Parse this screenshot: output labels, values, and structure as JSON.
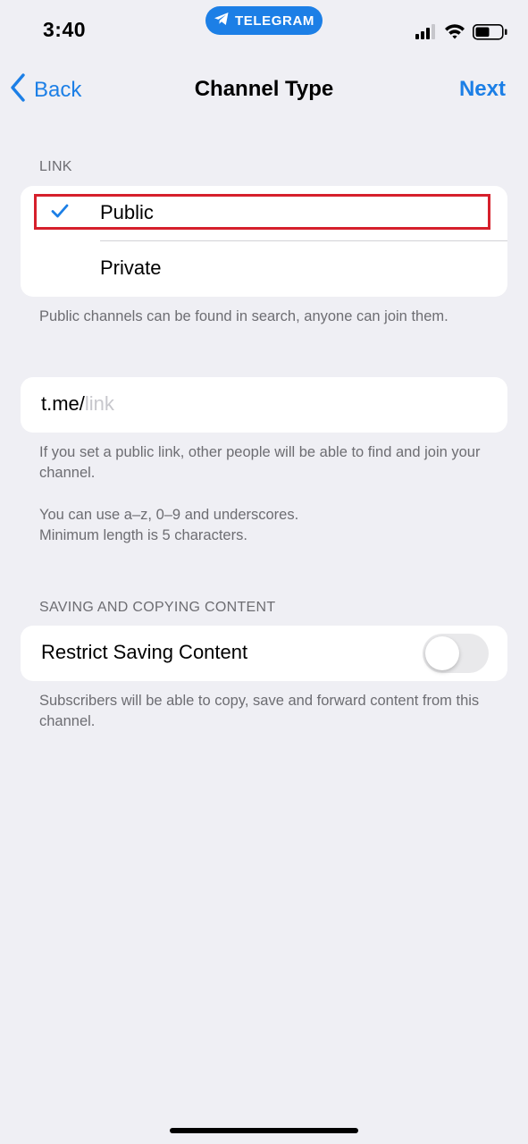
{
  "status_bar": {
    "time": "3:40",
    "app_name": "TELEGRAM",
    "icons": [
      "cellular-signal-icon",
      "wifi-icon",
      "battery-icon"
    ]
  },
  "nav": {
    "back_label": "Back",
    "title": "Channel Type",
    "next_label": "Next"
  },
  "link_section": {
    "header": "LINK",
    "options": [
      {
        "label": "Public",
        "selected": true
      },
      {
        "label": "Private",
        "selected": false
      }
    ],
    "footnote": "Public channels can be found in search, anyone can join them."
  },
  "public_link": {
    "prefix": "t.me/",
    "placeholder": "link",
    "footnote_1": "If you set a public link, other people will be able to find and join your channel.",
    "footnote_2_line1": "You can use a–z, 0–9 and underscores.",
    "footnote_2_line2": "Minimum length is 5 characters."
  },
  "saving_section": {
    "header": "SAVING AND COPYING CONTENT",
    "toggle_label": "Restrict Saving Content",
    "toggle_on": false,
    "footnote": "Subscribers will be able to copy, save and forward content from this channel."
  },
  "colors": {
    "accent": "#1c7fe6",
    "background": "#efeff4",
    "highlight": "#d6202c"
  }
}
